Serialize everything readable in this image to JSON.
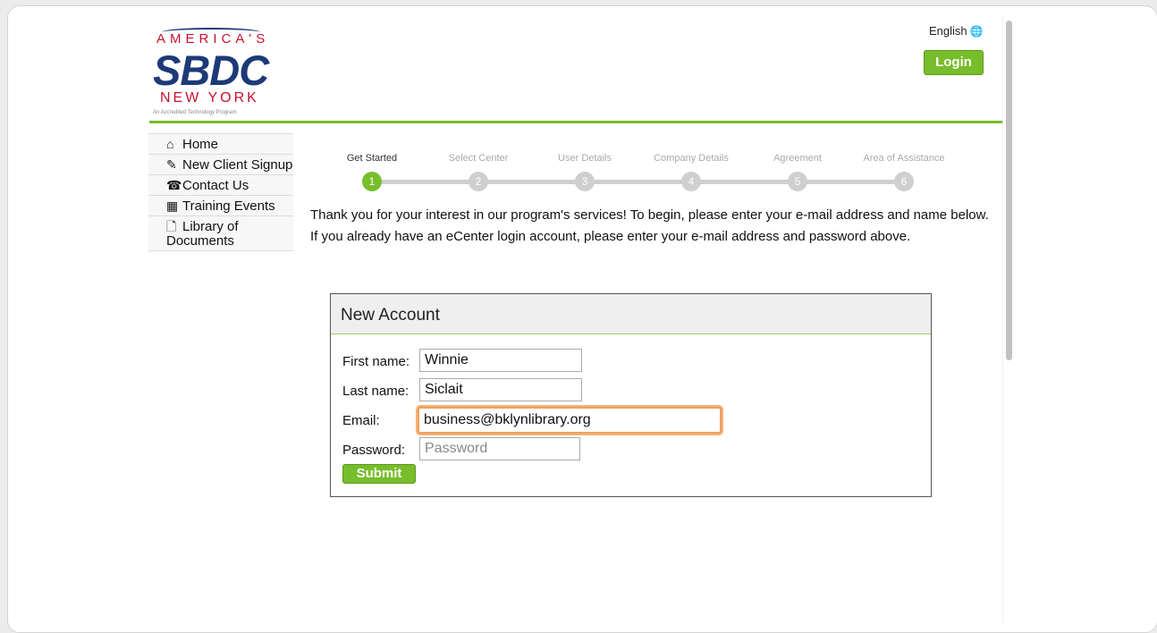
{
  "header": {
    "logo": {
      "top_text": "AMERICA'S",
      "main_text": "SBDC",
      "sub_text": "NEW YORK",
      "tagline": "An Accredited Technology Program"
    },
    "language": "English",
    "language_icon": "globe-icon",
    "login_label": "Login",
    "accent_color": "#78bd2b"
  },
  "sidebar": {
    "items": [
      {
        "icon": "home-icon",
        "label": "Home"
      },
      {
        "icon": "pencil-icon",
        "label": "New Client Signup"
      },
      {
        "icon": "phone-icon",
        "label": "Contact Us"
      },
      {
        "icon": "calendar-icon",
        "label": "Training Events"
      },
      {
        "icon": "document-icon",
        "label": "Library of Documents"
      }
    ]
  },
  "steps": [
    {
      "label": "Get Started",
      "number": "1",
      "active": true
    },
    {
      "label": "Select Center",
      "number": "2",
      "active": false
    },
    {
      "label": "User Details",
      "number": "3",
      "active": false
    },
    {
      "label": "Company Details",
      "number": "4",
      "active": false
    },
    {
      "label": "Agreement",
      "number": "5",
      "active": false
    },
    {
      "label": "Area of Assistance",
      "number": "6",
      "active": false
    }
  ],
  "intro_text": "Thank you for your interest in our program's services! To begin, please enter your e-mail address and name below. If you already have an eCenter login account, please enter your e-mail address and password above.",
  "form": {
    "title": "New Account",
    "first_name_label": "First name:",
    "first_name_value": "Winnie",
    "last_name_label": "Last name:",
    "last_name_value": "Siclait",
    "email_label": "Email:",
    "email_value": "business@bklynlibrary.org",
    "password_label": "Password:",
    "password_placeholder": "Password",
    "submit_label": "Submit"
  }
}
